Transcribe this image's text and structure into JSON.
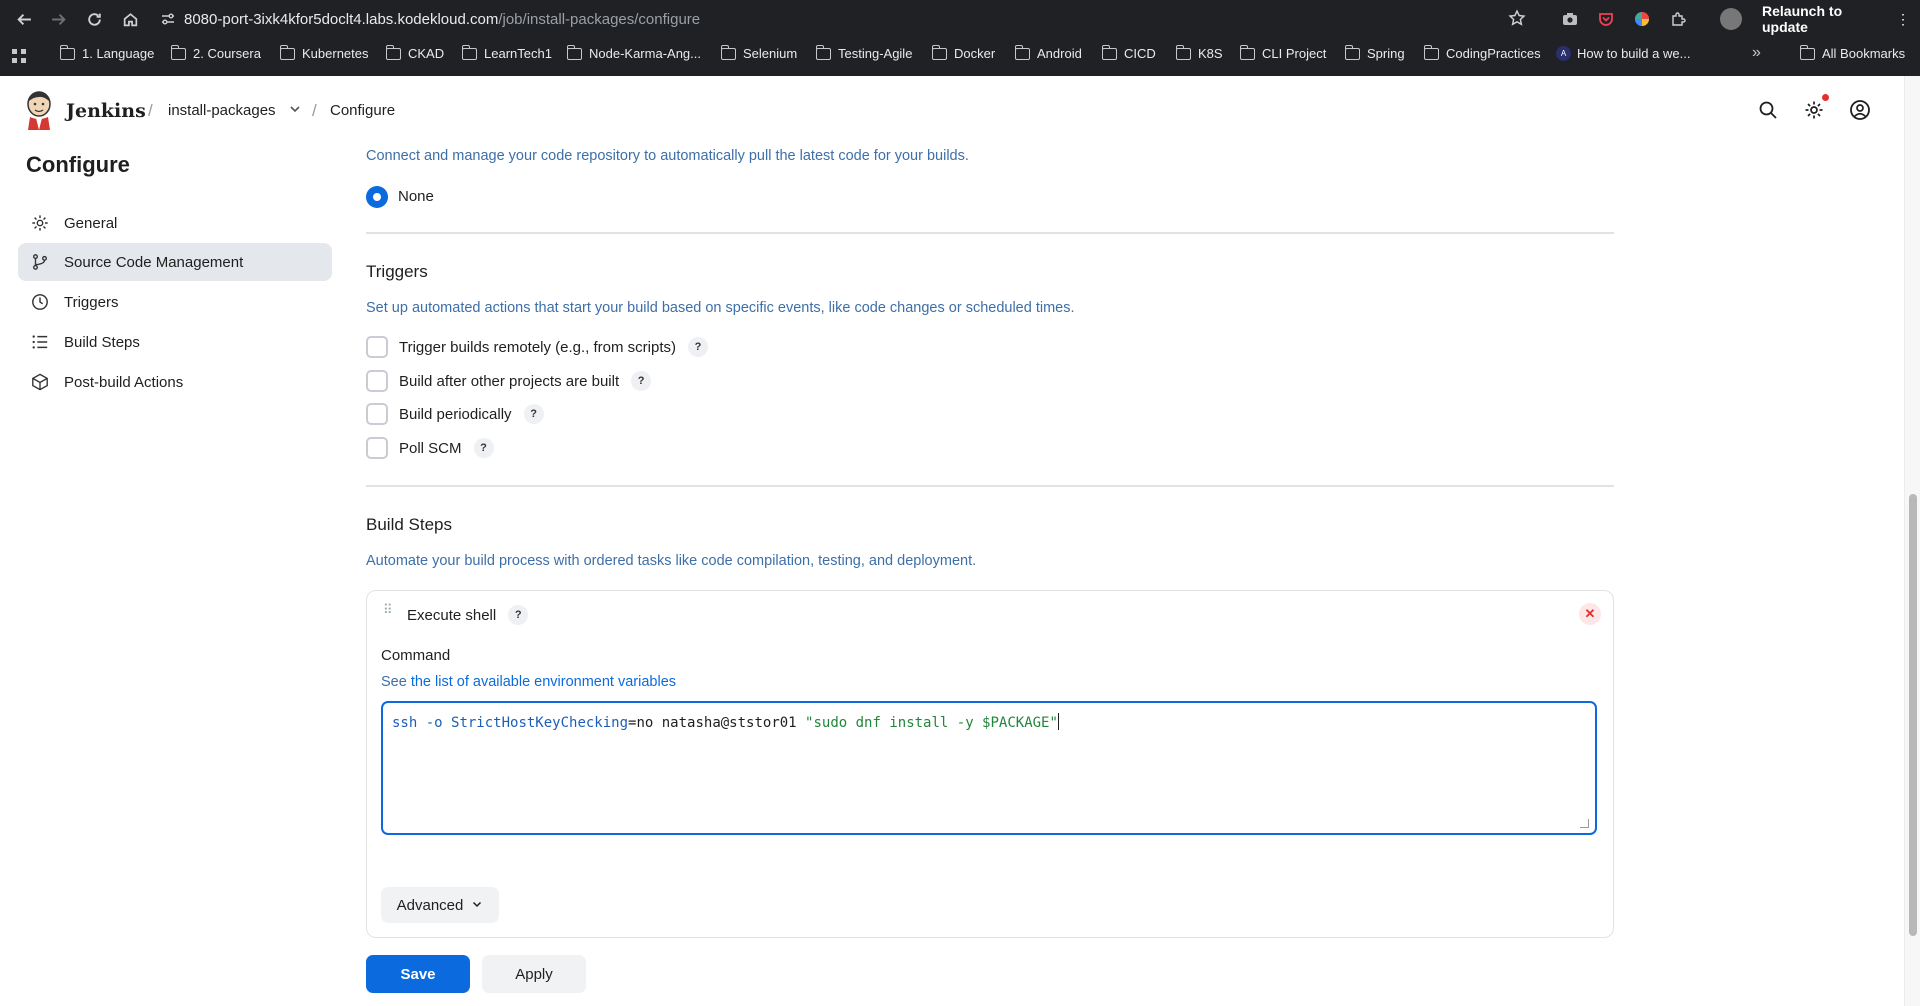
{
  "browser": {
    "url_host": "8080-port-3ixk4kfor5doclt4.labs.kodekloud.com",
    "url_path": "/job/install-packages/configure",
    "relaunch_label": "Relaunch to update",
    "bookmarks": [
      "1. Language",
      "2. Coursera",
      "Kubernetes",
      "CKAD",
      "LearnTech1",
      "Node-Karma-Ang...",
      "Selenium",
      "Testing-Agile",
      "Docker",
      "Android",
      "CICD",
      "K8S",
      "CLI Project",
      "Spring",
      "CodingPractices",
      "How to build a we..."
    ],
    "all_bookmarks_label": "All Bookmarks"
  },
  "header": {
    "app_name": "Jenkins",
    "breadcrumb_job": "install-packages",
    "breadcrumb_page": "Configure"
  },
  "sidebar": {
    "title": "Configure",
    "items": [
      {
        "label": "General",
        "icon": "gear-icon"
      },
      {
        "label": "Source Code Management",
        "icon": "branch-icon",
        "active": true
      },
      {
        "label": "Triggers",
        "icon": "clock-icon"
      },
      {
        "label": "Build Steps",
        "icon": "list-icon"
      },
      {
        "label": "Post-build Actions",
        "icon": "package-icon"
      }
    ]
  },
  "scm": {
    "description": "Connect and manage your code repository to automatically pull the latest code for your builds.",
    "option_none": "None"
  },
  "triggers": {
    "title": "Triggers",
    "description": "Set up automated actions that start your build based on specific events, like code changes or scheduled times.",
    "options": [
      "Trigger builds remotely (e.g., from scripts)",
      "Build after other projects are built",
      "Build periodically",
      "Poll SCM"
    ],
    "help_label": "?"
  },
  "build_steps": {
    "title": "Build Steps",
    "description": "Automate your build process with ordered tasks like code compilation, testing, and deployment.",
    "step_name": "Execute shell",
    "command_label": "Command",
    "env_prefix": "See ",
    "env_link": "the list of available environment variables",
    "command_parts": {
      "cmd1": "ssh",
      "opt": " -o ",
      "key": "StrictHostKeyChecking",
      "plain": "=no natasha@ststor01 ",
      "str": "\"sudo dnf install -y $PACKAGE\""
    },
    "advanced_label": "Advanced"
  },
  "footer": {
    "save_label": "Save",
    "apply_label": "Apply"
  }
}
